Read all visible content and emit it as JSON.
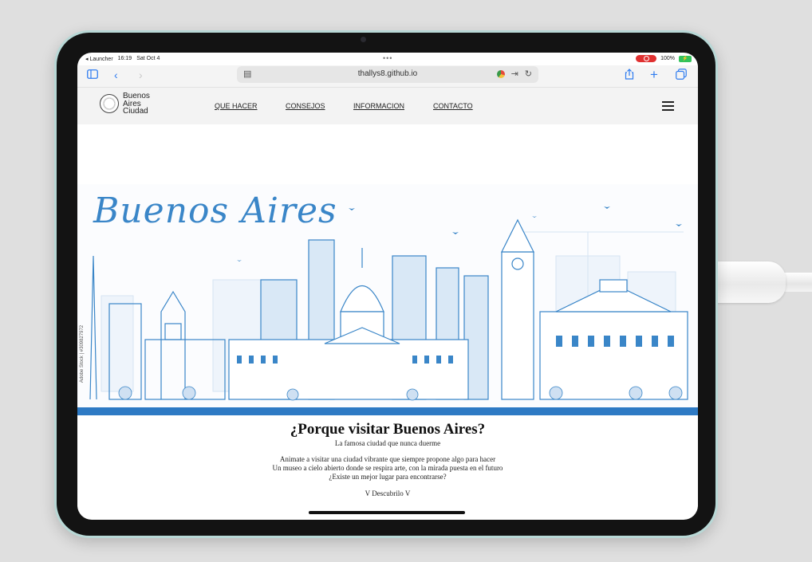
{
  "status": {
    "back_app": "◂ Launcher",
    "time": "16:19",
    "date": "Sat Oct 4",
    "dots": "•••",
    "battery": "100%"
  },
  "browser": {
    "url": "thallys8.github.io"
  },
  "site": {
    "logo_lines": [
      "Buenos",
      "Aires",
      "Ciudad"
    ],
    "nav": [
      "QUE HACER",
      "CONSEJOS",
      "INFORMACION",
      "CONTACTO"
    ]
  },
  "hero": {
    "title": "Buenos Aires",
    "credit": "Adobe Stock | #309827972"
  },
  "content": {
    "title": "¿Porque visitar Buenos Aires?",
    "subtitle": "La famosa ciudad que nunca duerme",
    "body": [
      "Animate a visitar una ciudad vibrante que siempre propone algo para hacer",
      "Un museo a cielo abierto donde se respira arte, con la mirada puesta en el futuro",
      "¿Existe un mejor lugar para encontrarse?"
    ],
    "cta": "V Descubrilo V"
  },
  "colors": {
    "accent": "#2f7cf0",
    "hero_blue": "#3a86c8",
    "skyline_dark": "#2e7ac4",
    "skyline_light": "#a9c9ea"
  }
}
